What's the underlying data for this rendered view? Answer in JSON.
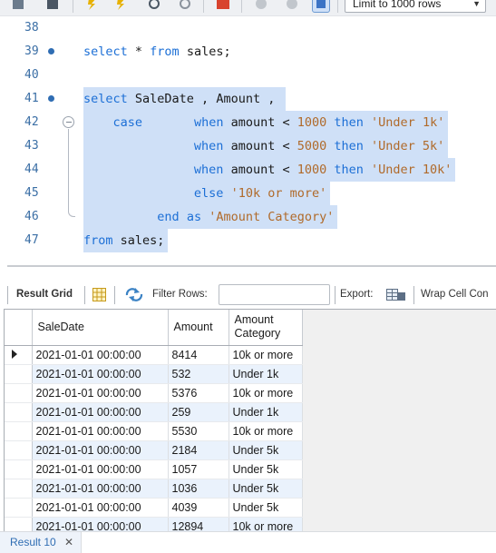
{
  "toolbar": {
    "limit_select": "Limit to 1000 rows",
    "icons": [
      "new-tab-icon",
      "save-icon",
      "execute-icon",
      "execute-current-icon",
      "explain-icon",
      "stop-icon",
      "stop-on-error-icon",
      "commit-icon",
      "rollback-icon",
      "autocommit-icon"
    ]
  },
  "editor": {
    "lines": [
      {
        "num": "38",
        "marker": false,
        "fold": "",
        "selected": false,
        "indent": "",
        "tokens": []
      },
      {
        "num": "39",
        "marker": true,
        "fold": "",
        "selected": false,
        "indent": "",
        "tokens": [
          {
            "t": "select",
            "c": "kw"
          },
          {
            "t": " * ",
            "c": "plain"
          },
          {
            "t": "from",
            "c": "kw"
          },
          {
            "t": " sales;",
            "c": "plain"
          }
        ]
      },
      {
        "num": "40",
        "marker": false,
        "fold": "",
        "selected": false,
        "indent": "",
        "tokens": []
      },
      {
        "num": "41",
        "marker": true,
        "fold": "",
        "selected": true,
        "indent": "",
        "tokens": [
          {
            "t": "select",
            "c": "kw"
          },
          {
            "t": " SaleDate , Amount , ",
            "c": "plain"
          }
        ]
      },
      {
        "num": "42",
        "marker": false,
        "fold": "start",
        "selected": true,
        "indent": "    ",
        "tokens": [
          {
            "t": "case",
            "c": "kw"
          },
          {
            "t": "       ",
            "c": "plain"
          },
          {
            "t": "when",
            "c": "kw"
          },
          {
            "t": " amount < ",
            "c": "plain"
          },
          {
            "t": "1000",
            "c": "num"
          },
          {
            "t": " ",
            "c": "plain"
          },
          {
            "t": "then",
            "c": "kw"
          },
          {
            "t": " ",
            "c": "plain"
          },
          {
            "t": "'Under 1k'",
            "c": "str"
          }
        ]
      },
      {
        "num": "43",
        "marker": false,
        "fold": "mid",
        "selected": true,
        "indent": "               ",
        "tokens": [
          {
            "t": "when",
            "c": "kw"
          },
          {
            "t": " amount < ",
            "c": "plain"
          },
          {
            "t": "5000",
            "c": "num"
          },
          {
            "t": " ",
            "c": "plain"
          },
          {
            "t": "then",
            "c": "kw"
          },
          {
            "t": " ",
            "c": "plain"
          },
          {
            "t": "'Under 5k'",
            "c": "str"
          }
        ]
      },
      {
        "num": "44",
        "marker": false,
        "fold": "mid",
        "selected": true,
        "indent": "               ",
        "tokens": [
          {
            "t": "when",
            "c": "kw"
          },
          {
            "t": " amount < ",
            "c": "plain"
          },
          {
            "t": "1000",
            "c": "num"
          },
          {
            "t": " ",
            "c": "plain"
          },
          {
            "t": "then",
            "c": "kw"
          },
          {
            "t": " ",
            "c": "plain"
          },
          {
            "t": "'Under 10k'",
            "c": "str"
          }
        ]
      },
      {
        "num": "45",
        "marker": false,
        "fold": "mid",
        "selected": true,
        "indent": "               ",
        "tokens": [
          {
            "t": "else",
            "c": "kw"
          },
          {
            "t": " ",
            "c": "plain"
          },
          {
            "t": "'10k or more'",
            "c": "str"
          }
        ]
      },
      {
        "num": "46",
        "marker": false,
        "fold": "end",
        "selected": true,
        "indent": "          ",
        "tokens": [
          {
            "t": "end",
            "c": "kw"
          },
          {
            "t": " ",
            "c": "plain"
          },
          {
            "t": "as",
            "c": "kw"
          },
          {
            "t": " ",
            "c": "plain"
          },
          {
            "t": "'Amount Category'",
            "c": "str"
          }
        ]
      },
      {
        "num": "47",
        "marker": false,
        "fold": "",
        "selected": true,
        "indent": "",
        "tokens": [
          {
            "t": "from",
            "c": "kw"
          },
          {
            "t": " sales;",
            "c": "plain"
          }
        ]
      }
    ]
  },
  "result_toolbar": {
    "result_grid_label": "Result Grid",
    "filter_rows_label": "Filter Rows:",
    "filter_value": "",
    "export_label": "Export:",
    "wrap_label": "Wrap Cell Con"
  },
  "grid": {
    "columns": [
      "SaleDate",
      "Amount",
      "Amount Category"
    ],
    "rows": [
      [
        "2021-01-01 00:00:00",
        "8414",
        "10k or more"
      ],
      [
        "2021-01-01 00:00:00",
        "532",
        "Under 1k"
      ],
      [
        "2021-01-01 00:00:00",
        "5376",
        "10k or more"
      ],
      [
        "2021-01-01 00:00:00",
        "259",
        "Under 1k"
      ],
      [
        "2021-01-01 00:00:00",
        "5530",
        "10k or more"
      ],
      [
        "2021-01-01 00:00:00",
        "2184",
        "Under 5k"
      ],
      [
        "2021-01-01 00:00:00",
        "1057",
        "Under 5k"
      ],
      [
        "2021-01-01 00:00:00",
        "1036",
        "Under 5k"
      ],
      [
        "2021-01-01 00:00:00",
        "4039",
        "Under 5k"
      ],
      [
        "2021-01-01 00:00:00",
        "12894",
        "10k or more"
      ]
    ],
    "current_row": 0
  },
  "tabs": {
    "result_tab": "Result 10"
  },
  "colors": {
    "keyword": "#1c6fd6",
    "string": "#b06a2a",
    "selection": "#cfe0f7",
    "alt_row": "#eaf2fc"
  }
}
